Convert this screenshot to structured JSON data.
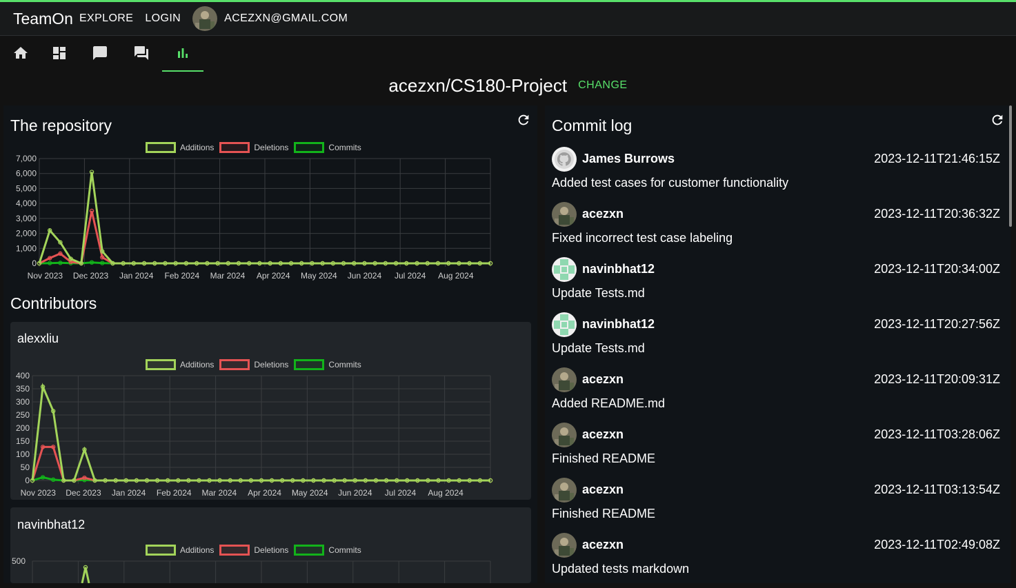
{
  "app": {
    "brand": "TeamOn",
    "nav": [
      "EXPLORE",
      "LOGIN"
    ],
    "user_email": "ACEZXN@GMAIL.COM",
    "accent": "#58e06a"
  },
  "toolbar": {
    "icons": [
      "home-icon",
      "dashboard-icon",
      "chat-icon",
      "forum-icon",
      "bar-chart-icon"
    ],
    "active": "bar-chart-icon"
  },
  "repo": {
    "name": "acezxn/CS180-Project",
    "change_label": "CHANGE"
  },
  "left": {
    "repository_title": "The repository",
    "contributors_title": "Contributors"
  },
  "legend": {
    "additions": "Additions",
    "deletions": "Deletions",
    "commits": "Commits"
  },
  "colors": {
    "additions": "#a3d45a",
    "deletions": "#e55353",
    "commits": "#12b31a"
  },
  "chart_data": [
    {
      "type": "line",
      "title": "The repository",
      "x_tick_labels": [
        "Nov 2023",
        "Dec 2023",
        "Jan 2024",
        "Feb 2024",
        "Mar 2024",
        "Apr 2024",
        "May 2024",
        "Jun 2024",
        "Jul 2024",
        "Aug 2024"
      ],
      "y_tick_labels": [
        "0",
        "1,000",
        "2,000",
        "3,000",
        "4,000",
        "5,000",
        "6,000",
        "7,000"
      ],
      "ylim": [
        0,
        7000
      ],
      "weeks": 44,
      "series": [
        {
          "name": "Additions",
          "values": [
            0,
            2200,
            1400,
            300,
            0,
            6100,
            800,
            0,
            0,
            0,
            0,
            0,
            0,
            0,
            0,
            0,
            0,
            0,
            0,
            0,
            0,
            0,
            0,
            0,
            0,
            0,
            0,
            0,
            0,
            0,
            0,
            0,
            0,
            0,
            0,
            0,
            0,
            0,
            0,
            0,
            0,
            0,
            0,
            0
          ]
        },
        {
          "name": "Deletions",
          "values": [
            0,
            350,
            650,
            100,
            0,
            3500,
            400,
            0,
            0,
            0,
            0,
            0,
            0,
            0,
            0,
            0,
            0,
            0,
            0,
            0,
            0,
            0,
            0,
            0,
            0,
            0,
            0,
            0,
            0,
            0,
            0,
            0,
            0,
            0,
            0,
            0,
            0,
            0,
            0,
            0,
            0,
            0,
            0,
            0
          ]
        },
        {
          "name": "Commits",
          "values": [
            0,
            15,
            30,
            12,
            0,
            60,
            20,
            0,
            0,
            0,
            0,
            0,
            0,
            0,
            0,
            0,
            0,
            0,
            0,
            0,
            0,
            0,
            0,
            0,
            0,
            0,
            0,
            0,
            0,
            0,
            0,
            0,
            0,
            0,
            0,
            0,
            0,
            0,
            0,
            0,
            0,
            0,
            0,
            0
          ]
        }
      ],
      "grid": true,
      "legend": "top-center"
    },
    {
      "type": "line",
      "title": "alexxliu",
      "x_tick_labels": [
        "Nov 2023",
        "Dec 2023",
        "Jan 2024",
        "Feb 2024",
        "Mar 2024",
        "Apr 2024",
        "May 2024",
        "Jun 2024",
        "Jul 2024",
        "Aug 2024"
      ],
      "y_tick_labels": [
        "0",
        "50",
        "100",
        "150",
        "200",
        "250",
        "300",
        "350",
        "400"
      ],
      "ylim": [
        0,
        400
      ],
      "weeks": 45,
      "series": [
        {
          "name": "Additions",
          "values": [
            0,
            358,
            265,
            0,
            0,
            118,
            0,
            0,
            0,
            0,
            0,
            0,
            0,
            0,
            0,
            0,
            0,
            0,
            0,
            0,
            0,
            0,
            0,
            0,
            0,
            0,
            0,
            0,
            0,
            0,
            0,
            0,
            0,
            0,
            0,
            0,
            0,
            0,
            0,
            0,
            0,
            0,
            0,
            0,
            0
          ]
        },
        {
          "name": "Deletions",
          "values": [
            0,
            128,
            128,
            0,
            0,
            10,
            0,
            0,
            0,
            0,
            0,
            0,
            0,
            0,
            0,
            0,
            0,
            0,
            0,
            0,
            0,
            0,
            0,
            0,
            0,
            0,
            0,
            0,
            0,
            0,
            0,
            0,
            0,
            0,
            0,
            0,
            0,
            0,
            0,
            0,
            0,
            0,
            0,
            0,
            0
          ]
        },
        {
          "name": "Commits",
          "values": [
            0,
            12,
            3,
            0,
            0,
            2,
            0,
            0,
            0,
            0,
            0,
            0,
            0,
            0,
            0,
            0,
            0,
            0,
            0,
            0,
            0,
            0,
            0,
            0,
            0,
            0,
            0,
            0,
            0,
            0,
            0,
            0,
            0,
            0,
            0,
            0,
            0,
            0,
            0,
            0,
            0,
            0,
            0,
            0,
            0
          ]
        }
      ],
      "grid": true,
      "legend": "top-center"
    },
    {
      "type": "line",
      "title": "navinbhat12",
      "y_tick_labels": [
        "500"
      ],
      "weeks": 45,
      "series": [
        {
          "name": "Additions",
          "values": [
            0,
            0,
            0,
            0,
            0,
            460,
            0,
            0,
            0,
            0
          ]
        },
        {
          "name": "Deletions",
          "values": []
        },
        {
          "name": "Commits",
          "values": []
        }
      ],
      "grid": true,
      "legend": "top-center"
    }
  ],
  "commit_log": {
    "title": "Commit log",
    "entries": [
      {
        "author": "James Burrows",
        "date": "2023-12-11T21:46:15Z",
        "message": "Added test cases for customer functionality",
        "avatar": "github-icon"
      },
      {
        "author": "acezxn",
        "date": "2023-12-11T20:36:32Z",
        "message": "Fixed incorrect test case labeling",
        "avatar": "photo"
      },
      {
        "author": "navinbhat12",
        "date": "2023-12-11T20:34:00Z",
        "message": "Update Tests.md",
        "avatar": "identicon"
      },
      {
        "author": "navinbhat12",
        "date": "2023-12-11T20:27:56Z",
        "message": "Update Tests.md",
        "avatar": "identicon"
      },
      {
        "author": "acezxn",
        "date": "2023-12-11T20:09:31Z",
        "message": "Added README.md",
        "avatar": "photo"
      },
      {
        "author": "acezxn",
        "date": "2023-12-11T03:28:06Z",
        "message": "Finished README",
        "avatar": "photo"
      },
      {
        "author": "acezxn",
        "date": "2023-12-11T03:13:54Z",
        "message": "Finished README",
        "avatar": "photo"
      },
      {
        "author": "acezxn",
        "date": "2023-12-11T02:49:08Z",
        "message": "Updated tests markdown",
        "avatar": "photo"
      }
    ]
  }
}
